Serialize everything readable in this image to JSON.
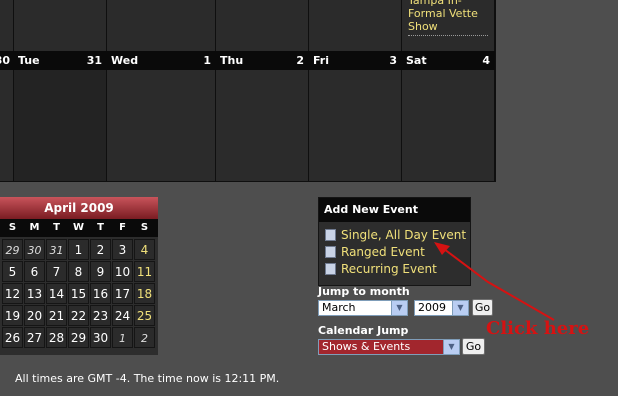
{
  "week": {
    "days": [
      {
        "name": "",
        "num": "30"
      },
      {
        "name": "Tue",
        "num": "31"
      },
      {
        "name": "Wed",
        "num": "1"
      },
      {
        "name": "Thu",
        "num": "2"
      },
      {
        "name": "Fri",
        "num": "3"
      },
      {
        "name": "Sat",
        "num": "4"
      }
    ],
    "event": "Tampa In-Formal Vette Show"
  },
  "mini_calendar": {
    "title": "April 2009",
    "weekday_headers": [
      "S",
      "M",
      "T",
      "W",
      "T",
      "F",
      "S"
    ],
    "weeks": [
      [
        "29",
        "30",
        "31",
        "1",
        "2",
        "3",
        "4"
      ],
      [
        "5",
        "6",
        "7",
        "8",
        "9",
        "10",
        "11"
      ],
      [
        "12",
        "13",
        "14",
        "15",
        "16",
        "17",
        "18"
      ],
      [
        "19",
        "20",
        "21",
        "22",
        "23",
        "24",
        "25"
      ],
      [
        "26",
        "27",
        "28",
        "29",
        "30",
        "1",
        "2"
      ]
    ]
  },
  "add_event": {
    "title": "Add New Event",
    "links": [
      "Single, All Day Event",
      "Ranged Event",
      "Recurring Event"
    ]
  },
  "jump_to_month": {
    "label": "Jump to month",
    "month": "March",
    "year": "2009",
    "go": "Go"
  },
  "calendar_jump": {
    "label": "Calendar Jump",
    "value": "Shows & Events",
    "go": "Go"
  },
  "annotation": "Click here",
  "footer": "All times are GMT -4. The time now is 12:11 PM.",
  "colors": {
    "event_link": "#f0e07a",
    "annotation": "#d61212",
    "mini_header": "#a2262d"
  }
}
